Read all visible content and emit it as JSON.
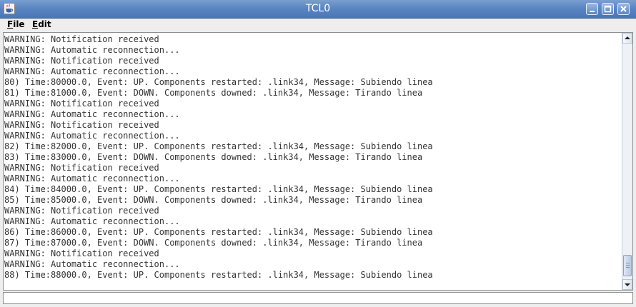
{
  "window": {
    "title": "TCL0"
  },
  "menu": [
    {
      "mnemonic": "F",
      "rest": "ile"
    },
    {
      "mnemonic": "E",
      "rest": "dit"
    }
  ],
  "console": {
    "lines": [
      "WARNING: Notification received",
      "WARNING: Automatic reconnection...",
      "WARNING: Notification received",
      "WARNING: Automatic reconnection...",
      "80) Time:80000.0, Event: UP. Components restarted: .link34, Message: Subiendo linea",
      "81) Time:81000.0, Event: DOWN. Components downed: .link34, Message: Tirando linea",
      "WARNING: Notification received",
      "WARNING: Automatic reconnection...",
      "WARNING: Notification received",
      "WARNING: Automatic reconnection...",
      "82) Time:82000.0, Event: UP. Components restarted: .link34, Message: Subiendo linea",
      "83) Time:83000.0, Event: DOWN. Components downed: .link34, Message: Tirando linea",
      "WARNING: Notification received",
      "WARNING: Automatic reconnection...",
      "84) Time:84000.0, Event: UP. Components restarted: .link34, Message: Subiendo linea",
      "85) Time:85000.0, Event: DOWN. Components downed: .link34, Message: Tirando linea",
      "WARNING: Notification received",
      "WARNING: Automatic reconnection...",
      "86) Time:86000.0, Event: UP. Components restarted: .link34, Message: Subiendo linea",
      "87) Time:87000.0, Event: DOWN. Components downed: .link34, Message: Tirando linea",
      "WARNING: Notification received",
      "WARNING: Automatic reconnection...",
      "88) Time:88000.0, Event: UP. Components restarted: .link34, Message: Subiendo linea"
    ],
    "scroll_position": 1.0
  },
  "command_input": {
    "value": ""
  },
  "icons": {
    "app": "java-cup-icon",
    "minimize": "minimize-icon",
    "maximize": "maximize-icon",
    "close": "close-icon",
    "scroll_up": "arrow-up-icon",
    "scroll_down": "arrow-down-icon"
  },
  "colors": {
    "titlebar": "#5b86c3",
    "title_text": "#ffffff",
    "console_bg": "#ffffff",
    "console_text": "#333333"
  }
}
